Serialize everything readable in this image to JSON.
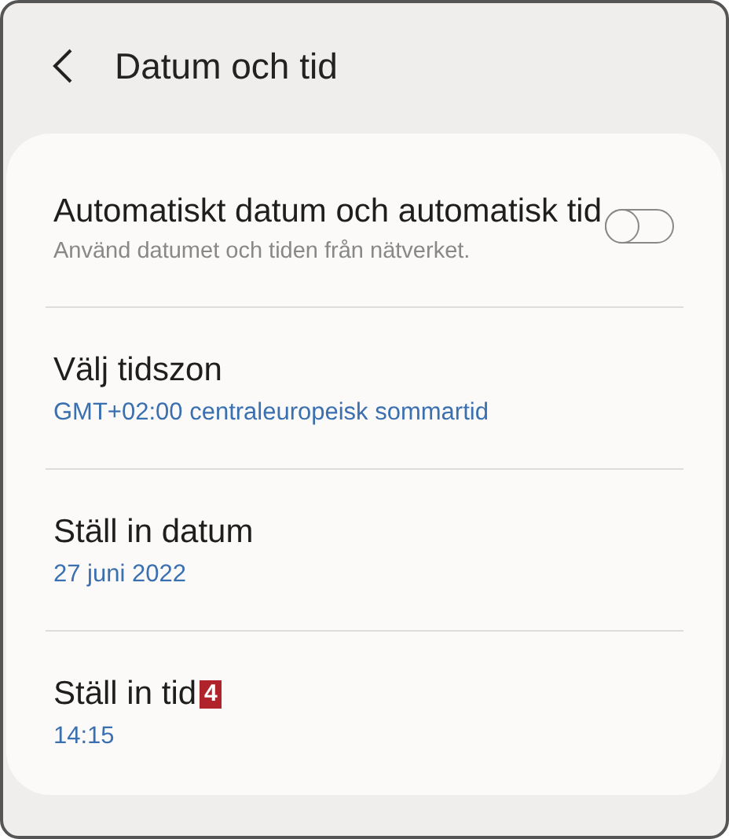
{
  "header": {
    "title": "Datum och tid"
  },
  "settings": [
    {
      "kind": "toggle",
      "title": "Automatiskt datum och automatisk tid",
      "subtitle": "Använd datumet och tiden från nätverket.",
      "on": false
    },
    {
      "kind": "value",
      "title": "Välj tidszon",
      "value": "GMT+02:00 centraleuropeisk sommartid"
    },
    {
      "kind": "value",
      "title": "Ställ in datum",
      "value": "27 juni 2022"
    },
    {
      "kind": "value",
      "title": "Ställ in tid",
      "badge": "4",
      "value": "14:15"
    }
  ]
}
